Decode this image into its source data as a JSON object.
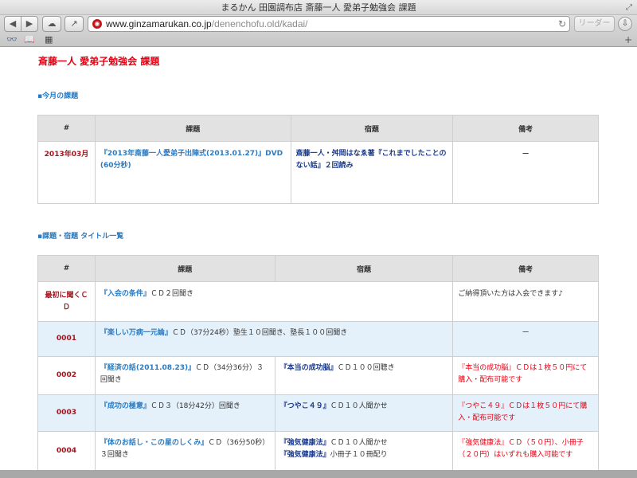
{
  "window": {
    "title": "まるかん 田園調布店 斎藤一人 愛弟子勉強会 課題",
    "url_host": "www.ginzamarukan.co.jp",
    "url_path": "/denenchofu.old/kadai/",
    "reader_label": "リーダー"
  },
  "page": {
    "title": "斎藤一人 愛弟子勉強会 課題",
    "section_monthly": "▪今月の課題",
    "section_list": "▪課題・宿題 タイトル一覧"
  },
  "headers": {
    "num": "#",
    "task": "課題",
    "homework": "宿題",
    "notes": "備考"
  },
  "monthly": {
    "month": "2013年03月",
    "task_link": "『2013年斎藤一人愛弟子出陣式(2013.01.27)』DVD",
    "task_duration": "(60分秒)",
    "homework": "斎藤一人・舛岡はなゑ著『これまでしたことのない話』２回読み",
    "notes": "ー"
  },
  "list": [
    {
      "num": "最初に聞くＣＤ",
      "task_link": "『入会の条件』",
      "task_text": "ＣＤ２回聞き",
      "homework_link": "",
      "homework_text": "",
      "notes": "ご納得頂いた方は入会できます♪"
    },
    {
      "num": "0001",
      "task_link": "『楽しい万病一元論』",
      "task_text": "ＣＤ（37分24秒）塾生１０回聞き、塾長１００回聞き",
      "homework_link": "",
      "homework_text": "",
      "notes": "ー"
    },
    {
      "num": "0002",
      "task_link": "『経済の話(2011.08.23)』",
      "task_text": "ＣＤ（34分36分）３回聞き",
      "homework_link": "『本当の成功脳』",
      "homework_text": "ＣＤ１００回聴き",
      "notes": "『本当の成功脳』ＣＤは１枚５０円にて購入・配布可能です"
    },
    {
      "num": "0003",
      "task_link": "『成功の極意』",
      "task_text": "ＣＤ３（18分42分）回聞き",
      "homework_link": "『つやこ４９』",
      "homework_text": "ＣＤ１０人聞かせ",
      "notes": "『つやこ４９』ＣＤは１枚５０円にて購入・配布可能です"
    },
    {
      "num": "0004",
      "task_link": "『体のお話し・この星のしくみ』",
      "task_text": "ＣＤ（36分50秒）３回聞き",
      "homework_link": "『強気健康法』",
      "homework_text": "ＣＤ１０人聞かせ",
      "homework_link2": "『強気健康法』",
      "homework_text2": "小冊子１０冊配り",
      "notes": "『強気健康法』ＣＤ（５０円）、小冊子（２０円）はいずれも購入可能です"
    }
  ]
}
